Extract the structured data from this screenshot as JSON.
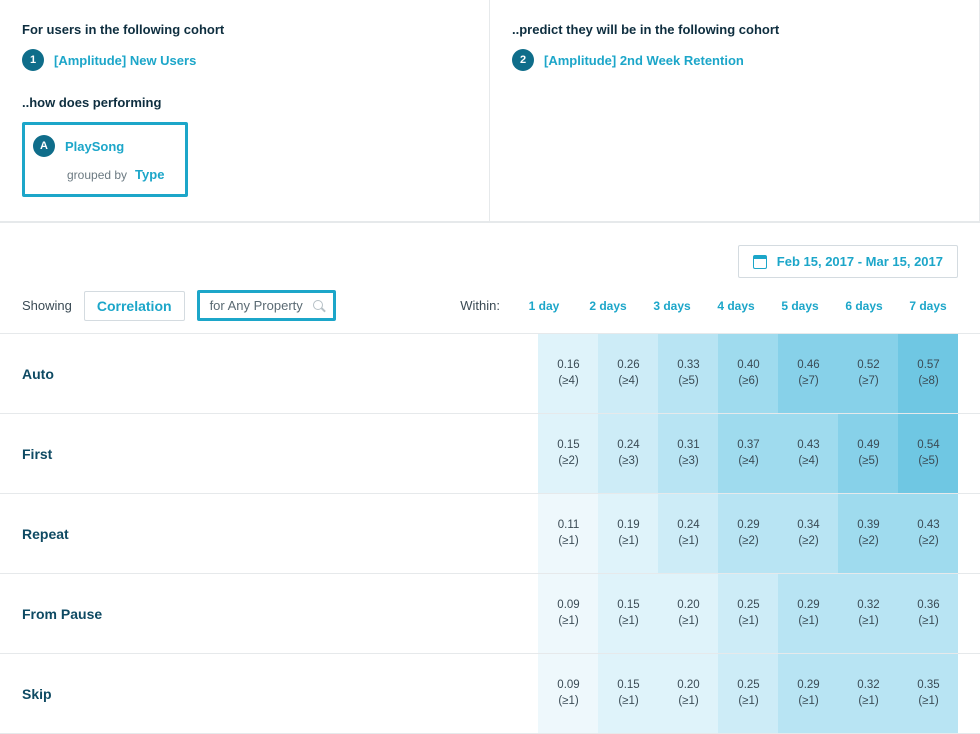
{
  "left": {
    "heading": "For users in the following cohort",
    "badge1": "1",
    "cohort1": "[Amplitude] New Users",
    "sub": "..how does performing",
    "badgeA": "A",
    "event": "PlaySong",
    "grouped_by": "grouped by",
    "group_prop": "Type"
  },
  "right": {
    "heading": "..predict they will be in the following cohort",
    "badge2": "2",
    "cohort2": "[Amplitude] 2nd Week Retention"
  },
  "results": {
    "date_range": "Feb 15, 2017 - Mar 15, 2017",
    "showing_label": "Showing",
    "metric": "Correlation",
    "property_scope": "for Any Property",
    "within_label": "Within:",
    "days": [
      "1 day",
      "2 days",
      "3 days",
      "4 days",
      "5 days",
      "6 days",
      "7 days"
    ]
  },
  "chart_data": {
    "type": "heatmap",
    "xlabel": "Within",
    "ylabel": "Type",
    "metric": "Correlation",
    "x": [
      "1 day",
      "2 days",
      "3 days",
      "4 days",
      "5 days",
      "6 days",
      "7 days"
    ],
    "rows": [
      {
        "label": "Auto",
        "values": [
          0.16,
          0.26,
          0.33,
          0.4,
          0.46,
          0.52,
          0.57
        ],
        "thresholds": [
          "≥4",
          "≥4",
          "≥5",
          "≥6",
          "≥7",
          "≥7",
          "≥8"
        ]
      },
      {
        "label": "First",
        "values": [
          0.15,
          0.24,
          0.31,
          0.37,
          0.43,
          0.49,
          0.54
        ],
        "thresholds": [
          "≥2",
          "≥3",
          "≥3",
          "≥4",
          "≥4",
          "≥5",
          "≥5"
        ]
      },
      {
        "label": "Repeat",
        "values": [
          0.11,
          0.19,
          0.24,
          0.29,
          0.34,
          0.39,
          0.43
        ],
        "thresholds": [
          "≥1",
          "≥1",
          "≥1",
          "≥2",
          "≥2",
          "≥2",
          "≥2"
        ]
      },
      {
        "label": "From Pause",
        "values": [
          0.09,
          0.15,
          0.2,
          0.25,
          0.29,
          0.32,
          0.36
        ],
        "thresholds": [
          "≥1",
          "≥1",
          "≥1",
          "≥1",
          "≥1",
          "≥1",
          "≥1"
        ]
      },
      {
        "label": "Skip",
        "values": [
          0.09,
          0.15,
          0.2,
          0.25,
          0.29,
          0.32,
          0.35
        ],
        "thresholds": [
          "≥1",
          "≥1",
          "≥1",
          "≥1",
          "≥1",
          "≥1",
          "≥1"
        ]
      }
    ]
  },
  "colors": {
    "scale": [
      "#eef8fc",
      "#dff3fa",
      "#cdecf7",
      "#b8e4f3",
      "#9fdbee",
      "#87d1e9",
      "#6fc7e3"
    ]
  }
}
